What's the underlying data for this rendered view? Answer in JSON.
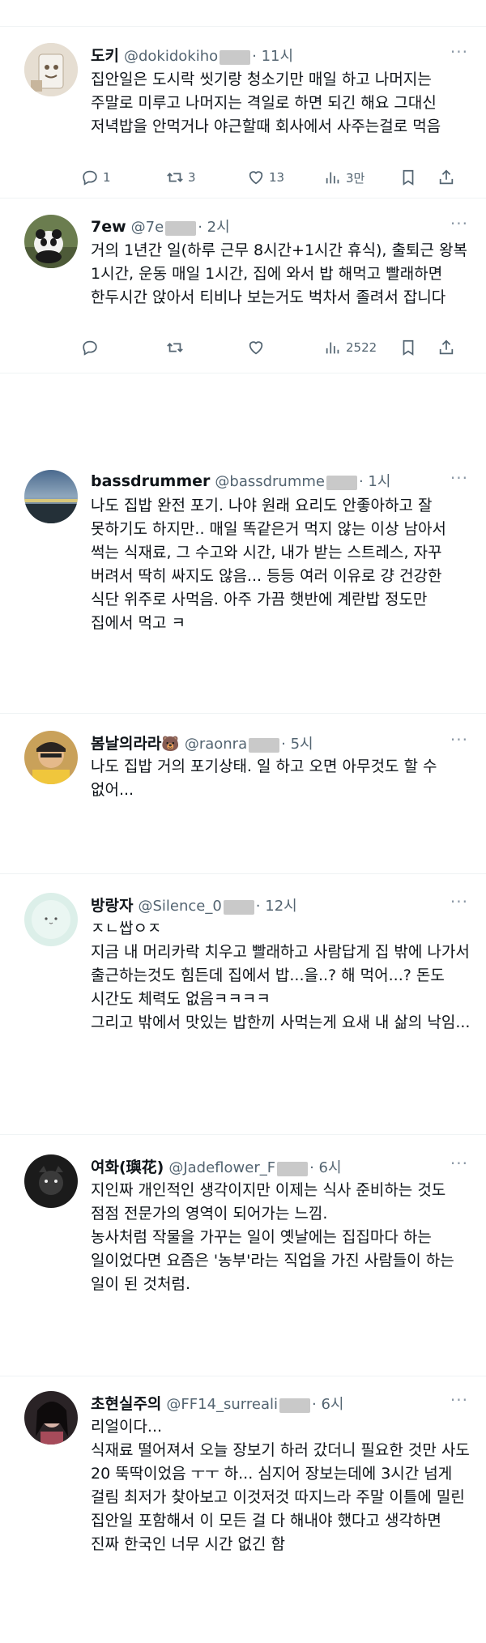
{
  "posts": [
    {
      "name": "도키",
      "handle": "@dokidokiho",
      "time": "· 11시",
      "body": "집안일은 도시락 씻기랑 청소기만 매일 하고 나머지는 주말로 미루고 나머지는 격일로 하면 되긴 해요 그대신 저녁밥을 안먹거나 야근할때 회사에서 사주는걸로 먹음",
      "replies": "1",
      "reposts": "3",
      "likes": "13",
      "views": "3만"
    },
    {
      "name": "7ew",
      "handle": "@7e",
      "time": "· 2시",
      "body": "거의 1년간 일(하루 근무 8시간+1시간 휴식), 출퇴근 왕복 1시간, 운동 매일 1시간, 집에 와서 밥 해먹고 빨래하면 한두시간 앉아서 티비나 보는거도 벅차서 졸려서 잡니다",
      "replies": "",
      "reposts": "",
      "likes": "",
      "views": "2522"
    },
    {
      "name": "bassdrummer",
      "handle": "@bassdrumme",
      "time": "· 1시",
      "body": "나도 집밥 완전 포기. 나야 원래 요리도 안좋아하고 잘 못하기도 하지만.. 매일 똑같은거 먹지 않는 이상 남아서 썩는 식재료, 그 수고와 시간, 내가 받는 스트레스, 자꾸 버려서 딱히 싸지도 않음... 등등 여러 이유로 걍 건강한 식단 위주로 사먹음. 아주 가끔 햇반에 계란밥 정도만 집에서 먹고 ㅋ"
    },
    {
      "name": "봄날의라라",
      "name_emoji": "🐻",
      "handle": "@raonra",
      "time": "· 5시",
      "body": "나도 집밥 거의 포기상태. 일 하고 오면 아무것도 할 수 없어..."
    },
    {
      "name": "방랑자",
      "handle": "@Silence_0",
      "time": "· 12시",
      "body": "ㅈㄴ쌉ㅇㅈ\n지금 내 머리카락 치우고 빨래하고 사람답게 집 밖에 나가서 출근하는것도 힘든데 집에서 밥...을..? 해 먹어...? 돈도 시간도 체력도 없음ㅋㅋㅋㅋ\n그리고 밖에서 맛있는 밥한끼 사먹는게 요새 내 삶의 낙임..."
    },
    {
      "name": "여화(璵花)",
      "handle": "@Jadeflower_F",
      "time": "· 6시",
      "body": "지인짜 개인적인 생각이지만 이제는 식사 준비하는 것도 점점 전문가의 영역이 되어가는 느낌.\n농사처럼 작물을 가꾸는 일이 옛날에는 집집마다 하는 일이었다면 요즘은 '농부'라는 직업을 가진 사람들이 하는 일이 된 것처럼."
    },
    {
      "name": "초현실주의",
      "handle": "@FF14_surreali",
      "time": "· 6시",
      "body": "리얼이다...\n식재료 떨어져서 오늘 장보기 하러 갔더니 필요한 것만 사도 20 뚝딱이었음 ㅜㅜ 하... 심지어 장보는데에 3시간 넘게 걸림 최저가 찾아보고 이것저것 따지느라 주말 이틀에 밀린 집안일 포함해서 이 모든 걸 다 해내야 했다고 생각하면 진짜 한국인 너무 시간 없긴 함"
    }
  ],
  "more_label": "···",
  "icons": {
    "reply": "reply-icon",
    "repost": "repost-icon",
    "like": "like-icon",
    "views": "views-icon",
    "bookmark": "bookmark-icon",
    "share": "share-icon"
  }
}
